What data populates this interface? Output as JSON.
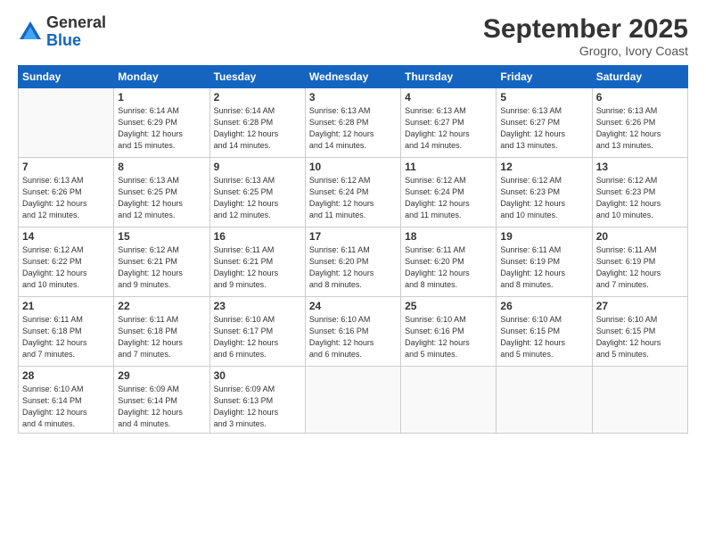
{
  "header": {
    "logo_general": "General",
    "logo_blue": "Blue",
    "month_title": "September 2025",
    "location": "Grogro, Ivory Coast"
  },
  "days_of_week": [
    "Sunday",
    "Monday",
    "Tuesday",
    "Wednesday",
    "Thursday",
    "Friday",
    "Saturday"
  ],
  "weeks": [
    [
      {
        "day": "",
        "sunrise": "",
        "sunset": "",
        "daylight": ""
      },
      {
        "day": "1",
        "sunrise": "Sunrise: 6:14 AM",
        "sunset": "Sunset: 6:29 PM",
        "daylight": "Daylight: 12 hours and 15 minutes."
      },
      {
        "day": "2",
        "sunrise": "Sunrise: 6:14 AM",
        "sunset": "Sunset: 6:28 PM",
        "daylight": "Daylight: 12 hours and 14 minutes."
      },
      {
        "day": "3",
        "sunrise": "Sunrise: 6:13 AM",
        "sunset": "Sunset: 6:28 PM",
        "daylight": "Daylight: 12 hours and 14 minutes."
      },
      {
        "day": "4",
        "sunrise": "Sunrise: 6:13 AM",
        "sunset": "Sunset: 6:27 PM",
        "daylight": "Daylight: 12 hours and 14 minutes."
      },
      {
        "day": "5",
        "sunrise": "Sunrise: 6:13 AM",
        "sunset": "Sunset: 6:27 PM",
        "daylight": "Daylight: 12 hours and 13 minutes."
      },
      {
        "day": "6",
        "sunrise": "Sunrise: 6:13 AM",
        "sunset": "Sunset: 6:26 PM",
        "daylight": "Daylight: 12 hours and 13 minutes."
      }
    ],
    [
      {
        "day": "7",
        "sunrise": "Sunrise: 6:13 AM",
        "sunset": "Sunset: 6:26 PM",
        "daylight": "Daylight: 12 hours and 12 minutes."
      },
      {
        "day": "8",
        "sunrise": "Sunrise: 6:13 AM",
        "sunset": "Sunset: 6:25 PM",
        "daylight": "Daylight: 12 hours and 12 minutes."
      },
      {
        "day": "9",
        "sunrise": "Sunrise: 6:13 AM",
        "sunset": "Sunset: 6:25 PM",
        "daylight": "Daylight: 12 hours and 12 minutes."
      },
      {
        "day": "10",
        "sunrise": "Sunrise: 6:12 AM",
        "sunset": "Sunset: 6:24 PM",
        "daylight": "Daylight: 12 hours and 11 minutes."
      },
      {
        "day": "11",
        "sunrise": "Sunrise: 6:12 AM",
        "sunset": "Sunset: 6:24 PM",
        "daylight": "Daylight: 12 hours and 11 minutes."
      },
      {
        "day": "12",
        "sunrise": "Sunrise: 6:12 AM",
        "sunset": "Sunset: 6:23 PM",
        "daylight": "Daylight: 12 hours and 10 minutes."
      },
      {
        "day": "13",
        "sunrise": "Sunrise: 6:12 AM",
        "sunset": "Sunset: 6:23 PM",
        "daylight": "Daylight: 12 hours and 10 minutes."
      }
    ],
    [
      {
        "day": "14",
        "sunrise": "Sunrise: 6:12 AM",
        "sunset": "Sunset: 6:22 PM",
        "daylight": "Daylight: 12 hours and 10 minutes."
      },
      {
        "day": "15",
        "sunrise": "Sunrise: 6:12 AM",
        "sunset": "Sunset: 6:21 PM",
        "daylight": "Daylight: 12 hours and 9 minutes."
      },
      {
        "day": "16",
        "sunrise": "Sunrise: 6:11 AM",
        "sunset": "Sunset: 6:21 PM",
        "daylight": "Daylight: 12 hours and 9 minutes."
      },
      {
        "day": "17",
        "sunrise": "Sunrise: 6:11 AM",
        "sunset": "Sunset: 6:20 PM",
        "daylight": "Daylight: 12 hours and 8 minutes."
      },
      {
        "day": "18",
        "sunrise": "Sunrise: 6:11 AM",
        "sunset": "Sunset: 6:20 PM",
        "daylight": "Daylight: 12 hours and 8 minutes."
      },
      {
        "day": "19",
        "sunrise": "Sunrise: 6:11 AM",
        "sunset": "Sunset: 6:19 PM",
        "daylight": "Daylight: 12 hours and 8 minutes."
      },
      {
        "day": "20",
        "sunrise": "Sunrise: 6:11 AM",
        "sunset": "Sunset: 6:19 PM",
        "daylight": "Daylight: 12 hours and 7 minutes."
      }
    ],
    [
      {
        "day": "21",
        "sunrise": "Sunrise: 6:11 AM",
        "sunset": "Sunset: 6:18 PM",
        "daylight": "Daylight: 12 hours and 7 minutes."
      },
      {
        "day": "22",
        "sunrise": "Sunrise: 6:11 AM",
        "sunset": "Sunset: 6:18 PM",
        "daylight": "Daylight: 12 hours and 7 minutes."
      },
      {
        "day": "23",
        "sunrise": "Sunrise: 6:10 AM",
        "sunset": "Sunset: 6:17 PM",
        "daylight": "Daylight: 12 hours and 6 minutes."
      },
      {
        "day": "24",
        "sunrise": "Sunrise: 6:10 AM",
        "sunset": "Sunset: 6:16 PM",
        "daylight": "Daylight: 12 hours and 6 minutes."
      },
      {
        "day": "25",
        "sunrise": "Sunrise: 6:10 AM",
        "sunset": "Sunset: 6:16 PM",
        "daylight": "Daylight: 12 hours and 5 minutes."
      },
      {
        "day": "26",
        "sunrise": "Sunrise: 6:10 AM",
        "sunset": "Sunset: 6:15 PM",
        "daylight": "Daylight: 12 hours and 5 minutes."
      },
      {
        "day": "27",
        "sunrise": "Sunrise: 6:10 AM",
        "sunset": "Sunset: 6:15 PM",
        "daylight": "Daylight: 12 hours and 5 minutes."
      }
    ],
    [
      {
        "day": "28",
        "sunrise": "Sunrise: 6:10 AM",
        "sunset": "Sunset: 6:14 PM",
        "daylight": "Daylight: 12 hours and 4 minutes."
      },
      {
        "day": "29",
        "sunrise": "Sunrise: 6:09 AM",
        "sunset": "Sunset: 6:14 PM",
        "daylight": "Daylight: 12 hours and 4 minutes."
      },
      {
        "day": "30",
        "sunrise": "Sunrise: 6:09 AM",
        "sunset": "Sunset: 6:13 PM",
        "daylight": "Daylight: 12 hours and 3 minutes."
      },
      {
        "day": "",
        "sunrise": "",
        "sunset": "",
        "daylight": ""
      },
      {
        "day": "",
        "sunrise": "",
        "sunset": "",
        "daylight": ""
      },
      {
        "day": "",
        "sunrise": "",
        "sunset": "",
        "daylight": ""
      },
      {
        "day": "",
        "sunrise": "",
        "sunset": "",
        "daylight": ""
      }
    ]
  ]
}
